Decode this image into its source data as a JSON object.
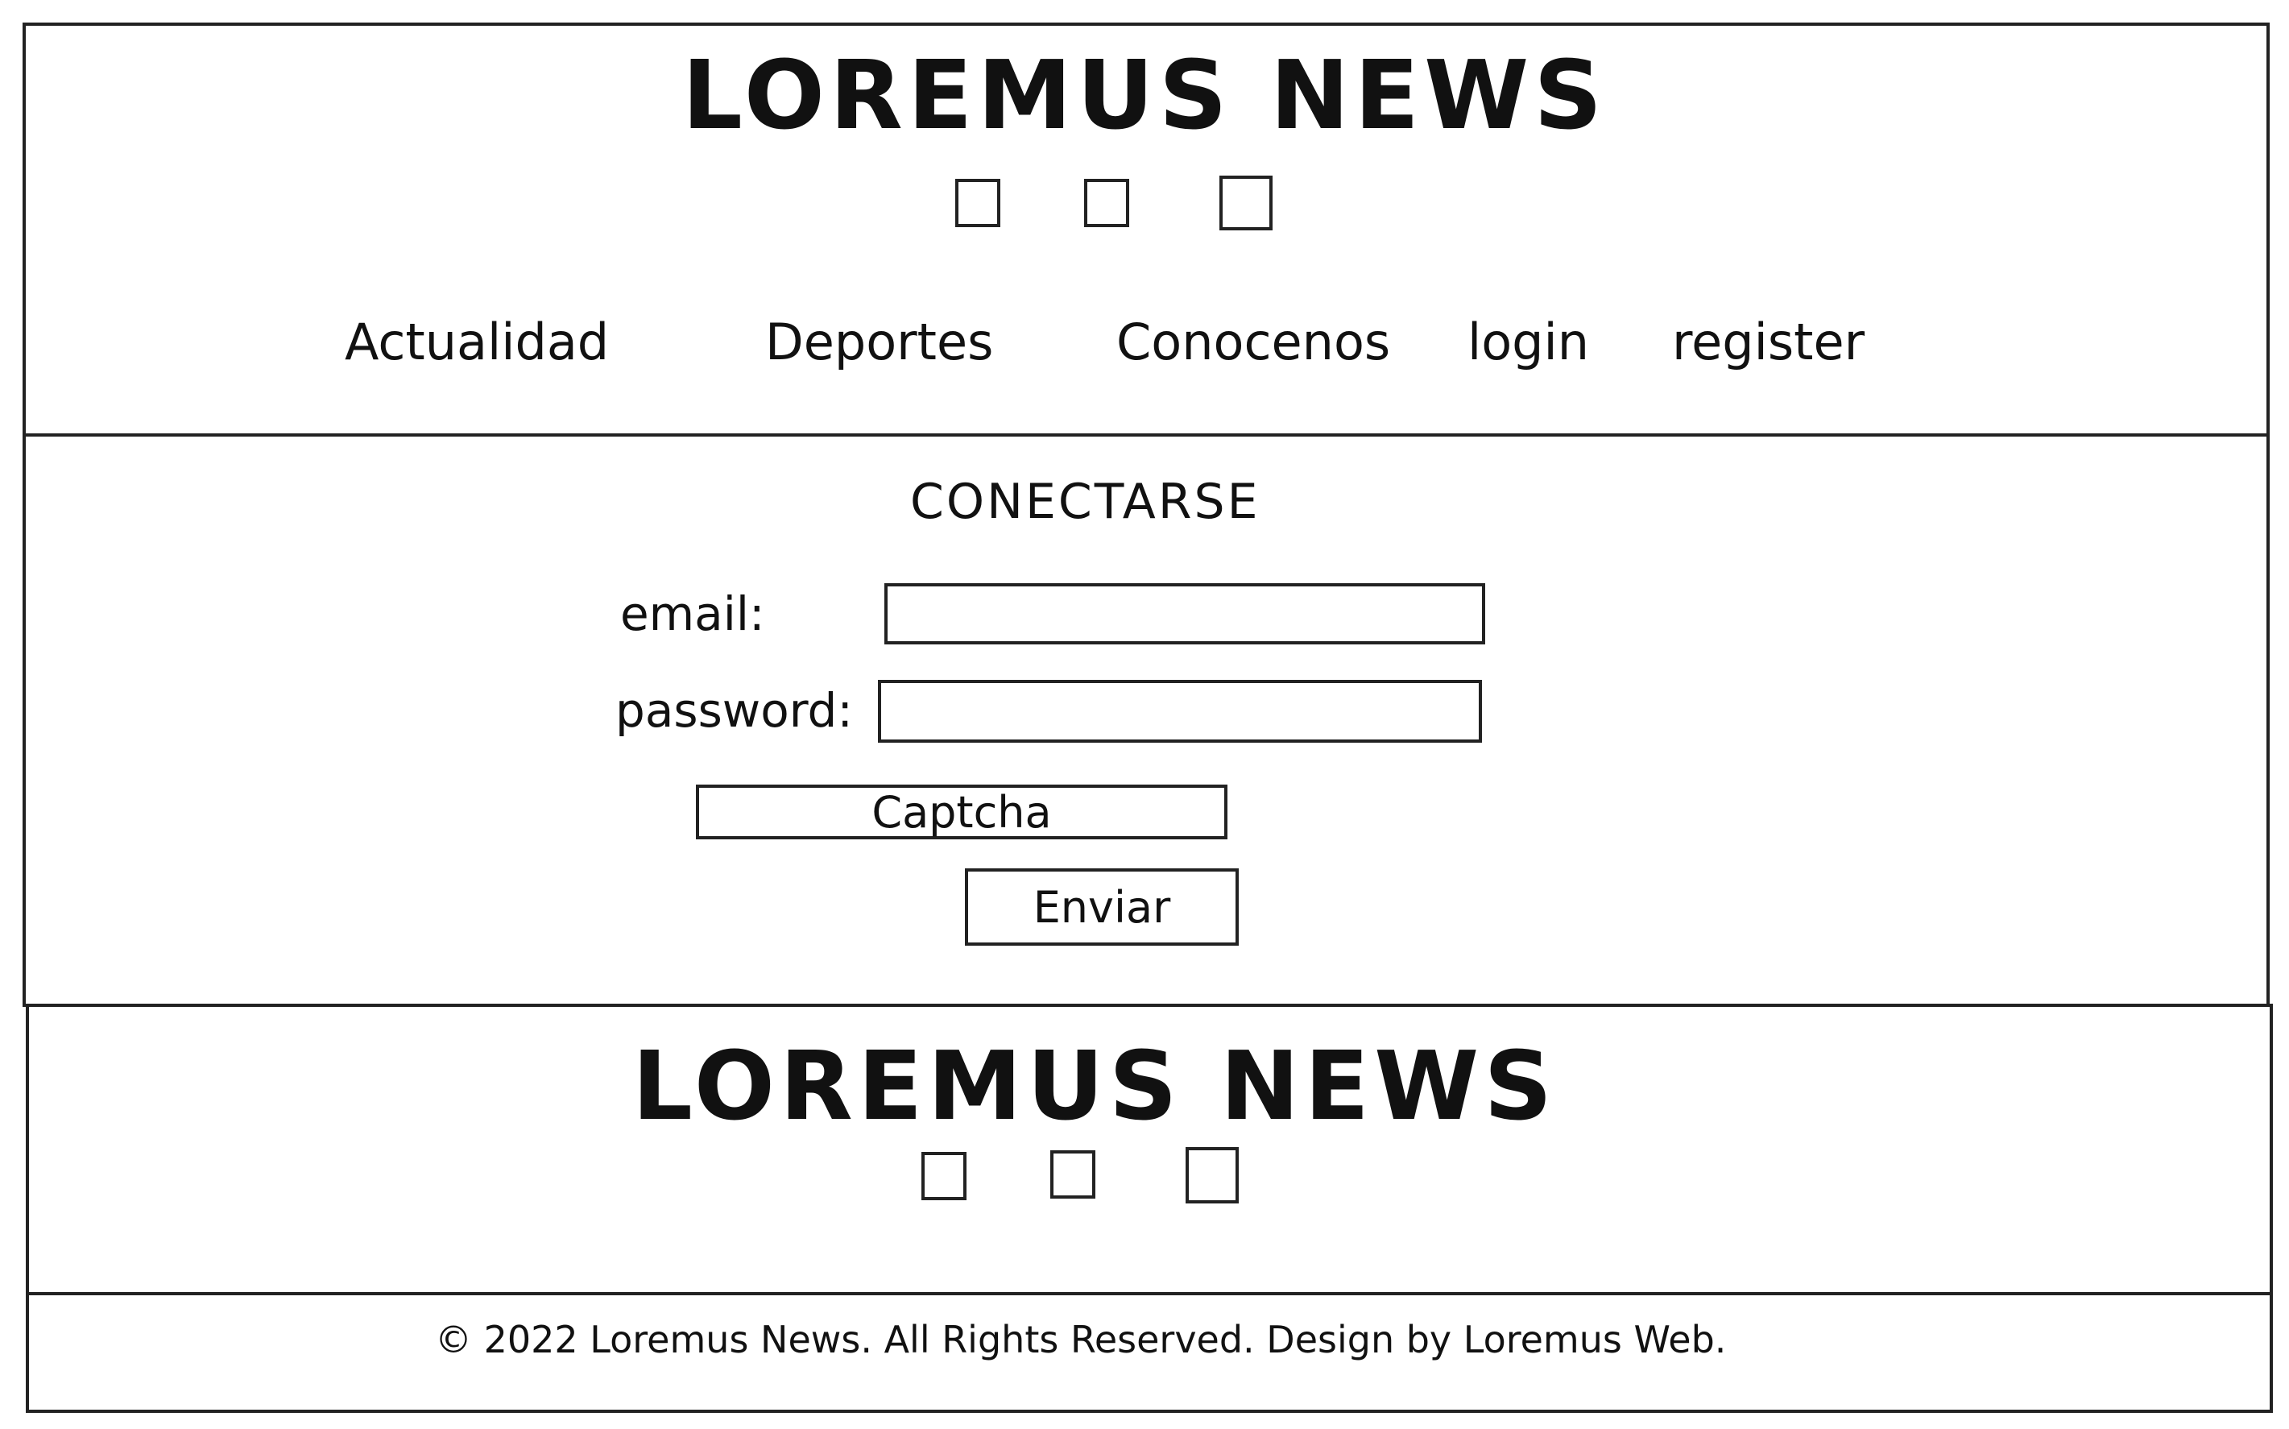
{
  "header": {
    "logo": "LOREMUS NEWS",
    "social_icons": [
      "social-icon-1",
      "social-icon-2",
      "social-icon-3"
    ],
    "nav": [
      {
        "label": "Actualidad"
      },
      {
        "label": "Deportes"
      },
      {
        "label": "Conocenos"
      },
      {
        "label": "login"
      },
      {
        "label": "register"
      }
    ]
  },
  "login": {
    "heading": "CONECTARSE",
    "email_label": "email:",
    "email_value": "",
    "password_label": "password:",
    "password_value": "",
    "captcha_label": "Captcha",
    "submit_label": "Enviar"
  },
  "footer": {
    "logo": "LOREMUS NEWS",
    "social_icons": [
      "social-icon-1",
      "social-icon-2",
      "social-icon-3"
    ],
    "copyright": "© 2022 Loremus News. All Rights Reserved. Design by Loremus Web."
  },
  "colors": {
    "ink": "#222222",
    "background": "#ffffff"
  }
}
